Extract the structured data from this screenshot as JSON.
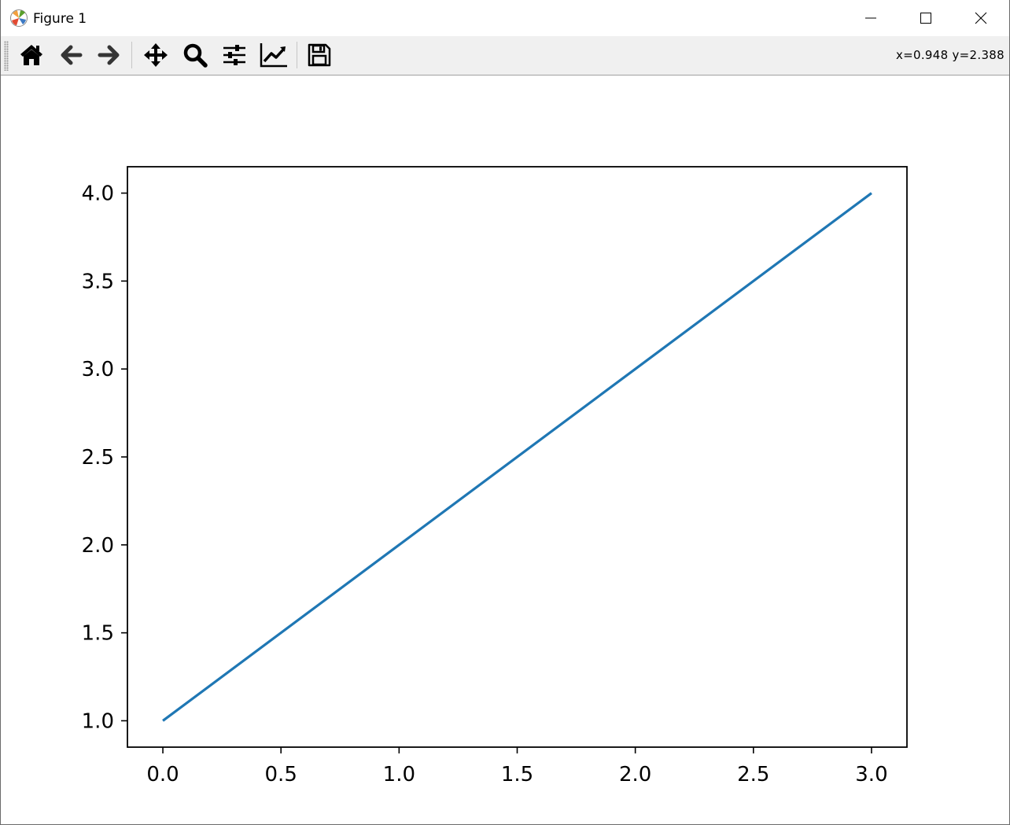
{
  "window": {
    "title": "Figure 1"
  },
  "toolbar": {
    "buttons": [
      {
        "icon": "home-icon"
      },
      {
        "icon": "back-arrow-icon"
      },
      {
        "icon": "forward-arrow-icon"
      },
      {
        "icon": "pan-move-icon"
      },
      {
        "icon": "zoom-magnifier-icon"
      },
      {
        "icon": "subplots-sliders-icon"
      },
      {
        "icon": "edit-axes-curve-icon"
      },
      {
        "icon": "save-floppy-icon"
      }
    ],
    "coordinates": "x=0.948 y=2.388"
  },
  "colors": {
    "line": "#1f77b4",
    "toolbar_bg": "#f0f0f0"
  },
  "chart_data": {
    "type": "line",
    "title": "",
    "xlabel": "",
    "ylabel": "",
    "x": [
      0,
      1,
      2,
      3
    ],
    "series": [
      {
        "values": [
          1,
          2,
          3,
          4
        ],
        "color": "#1f77b4"
      }
    ],
    "xlim": [
      -0.15,
      3.15
    ],
    "ylim": [
      0.85,
      4.15
    ],
    "xticks": [
      0.0,
      0.5,
      1.0,
      1.5,
      2.0,
      2.5,
      3.0
    ],
    "xtick_labels": [
      "0.0",
      "0.5",
      "1.0",
      "1.5",
      "2.0",
      "2.5",
      "3.0"
    ],
    "yticks": [
      1.0,
      1.5,
      2.0,
      2.5,
      3.0,
      3.5,
      4.0
    ],
    "ytick_labels": [
      "1.0",
      "1.5",
      "2.0",
      "2.5",
      "3.0",
      "3.5",
      "4.0"
    ],
    "grid": false,
    "legend": "none"
  }
}
